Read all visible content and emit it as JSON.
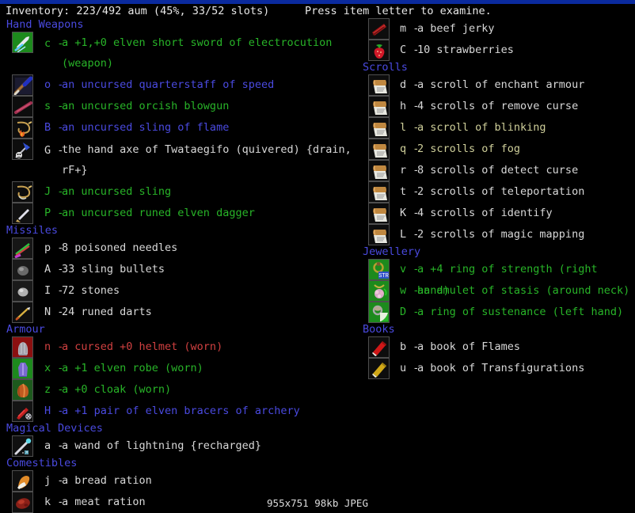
{
  "topbar": {
    "color": "#0a2a9e"
  },
  "status": {
    "inventory": "Inventory: 223/492 aum (45%, 33/52 slots)",
    "hint": "Press item letter to examine."
  },
  "footer": {
    "text": "955x751 98kb JPEG"
  },
  "colors": {
    "header": "#4a4ae0",
    "green": "#28b428",
    "blue": "#4a4ae0",
    "white": "#d8d8d8",
    "red": "#d04040",
    "cream": "#cfcf9a",
    "background": "#000000"
  },
  "left_column": [
    {
      "category": "Hand Weapons",
      "items": [
        {
          "letter": "c",
          "text": "a +1,+0 elven short sword of electrocution\n(weapon)",
          "color": "green",
          "icon": "short-sword-icon",
          "tall": true
        },
        {
          "letter": "o",
          "text": "an uncursed quarterstaff of speed",
          "color": "blue",
          "icon": "quarterstaff-icon",
          "tall": false
        },
        {
          "letter": "s",
          "text": "an uncursed orcish blowgun",
          "color": "green",
          "icon": "blowgun-icon",
          "tall": false
        },
        {
          "letter": "B",
          "text": "an uncursed sling of flame",
          "color": "blue",
          "icon": "sling-flame-icon",
          "tall": false
        },
        {
          "letter": "G",
          "text": "the hand axe of Twataegifo (quivered) {drain,\nrF+}",
          "color": "white",
          "icon": "hand-axe-icon",
          "tall": true
        },
        {
          "letter": "J",
          "text": "an uncursed sling",
          "color": "green",
          "icon": "sling-icon",
          "tall": false
        },
        {
          "letter": "P",
          "text": "an uncursed runed elven dagger",
          "color": "green",
          "icon": "dagger-icon",
          "tall": false
        }
      ]
    },
    {
      "category": "Missiles",
      "items": [
        {
          "letter": "p",
          "text": "8 poisoned needles",
          "color": "white",
          "icon": "needle-icon",
          "tall": false
        },
        {
          "letter": "A",
          "text": "33 sling bullets",
          "color": "white",
          "icon": "sling-bullet-icon",
          "tall": false
        },
        {
          "letter": "I",
          "text": "72 stones",
          "color": "white",
          "icon": "stone-icon",
          "tall": false
        },
        {
          "letter": "N",
          "text": "24 runed darts",
          "color": "white",
          "icon": "dart-icon",
          "tall": false
        }
      ]
    },
    {
      "category": "Armour",
      "items": [
        {
          "letter": "n",
          "text": "a cursed +0 helmet (worn)",
          "color": "red",
          "icon": "helmet-icon",
          "tall": false
        },
        {
          "letter": "x",
          "text": "a +1 elven robe (worn)",
          "color": "green",
          "icon": "robe-icon",
          "tall": false
        },
        {
          "letter": "z",
          "text": "a +0 cloak (worn)",
          "color": "green",
          "icon": "cloak-icon",
          "tall": false
        },
        {
          "letter": "H",
          "text": "a +1 pair of elven bracers of archery",
          "color": "blue",
          "icon": "bracers-icon",
          "tall": false
        }
      ]
    },
    {
      "category": "Magical Devices",
      "items": [
        {
          "letter": "a",
          "text": "a wand of lightning {recharged}",
          "color": "white",
          "icon": "wand-icon",
          "tall": false
        }
      ]
    },
    {
      "category": "Comestibles",
      "items": [
        {
          "letter": "j",
          "text": "a bread ration",
          "color": "white",
          "icon": "bread-ration-icon",
          "tall": false
        },
        {
          "letter": "k",
          "text": "a meat ration",
          "color": "white",
          "icon": "meat-ration-icon",
          "tall": false
        }
      ]
    }
  ],
  "right_column": [
    {
      "category": "",
      "items": [
        {
          "letter": "m",
          "text": "a beef jerky",
          "color": "white",
          "icon": "beef-jerky-icon",
          "tall": false
        },
        {
          "letter": "C",
          "text": "10 strawberries",
          "color": "white",
          "icon": "strawberry-icon",
          "tall": false
        }
      ]
    },
    {
      "category": "Scrolls",
      "items": [
        {
          "letter": "d",
          "text": "a scroll of enchant armour",
          "color": "white",
          "icon": "scroll-icon",
          "tall": false
        },
        {
          "letter": "h",
          "text": "4 scrolls of remove curse",
          "color": "white",
          "icon": "scroll-icon",
          "tall": false
        },
        {
          "letter": "l",
          "text": "a scroll of blinking",
          "color": "cream",
          "icon": "scroll-icon",
          "tall": false
        },
        {
          "letter": "q",
          "text": "2 scrolls of fog",
          "color": "cream",
          "icon": "scroll-icon",
          "tall": false
        },
        {
          "letter": "r",
          "text": "8 scrolls of detect curse",
          "color": "white",
          "icon": "scroll-icon",
          "tall": false
        },
        {
          "letter": "t",
          "text": "2 scrolls of teleportation",
          "color": "white",
          "icon": "scroll-icon",
          "tall": false
        },
        {
          "letter": "K",
          "text": "4 scrolls of identify",
          "color": "white",
          "icon": "scroll-icon",
          "tall": false
        },
        {
          "letter": "L",
          "text": "2 scrolls of magic mapping",
          "color": "white",
          "icon": "scroll-icon",
          "tall": false
        }
      ]
    },
    {
      "category": "Jewellery",
      "items": [
        {
          "letter": "v",
          "text": "a +4 ring of strength (right hand)",
          "color": "green",
          "icon": "ring-strength-icon",
          "tall": false
        },
        {
          "letter": "w",
          "text": "an amulet of stasis (around neck)",
          "color": "green",
          "icon": "amulet-icon",
          "tall": false
        },
        {
          "letter": "D",
          "text": "a ring of sustenance (left hand)",
          "color": "green",
          "icon": "ring-icon",
          "tall": false
        }
      ]
    },
    {
      "category": "Books",
      "items": [
        {
          "letter": "b",
          "text": "a book of Flames",
          "color": "white",
          "icon": "book-red-icon",
          "tall": false
        },
        {
          "letter": "u",
          "text": "a book of Transfigurations",
          "color": "white",
          "icon": "book-gold-icon",
          "tall": false
        }
      ]
    }
  ]
}
